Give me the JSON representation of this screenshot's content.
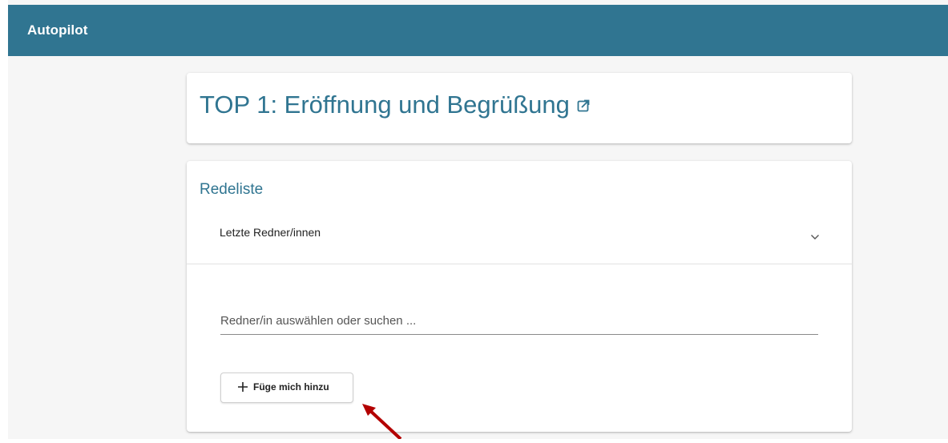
{
  "header": {
    "title": "Autopilot",
    "background_color": "#307591"
  },
  "agenda_item": {
    "title": "TOP 1: Eröffnung und Begrüßung",
    "link_icon": "external-link-icon"
  },
  "speakers": {
    "section_title": "Redeliste",
    "last_speakers_label": "Letzte Redner/innen",
    "expand_icon": "chevron-down-icon",
    "search_placeholder": "Redner/in auswählen oder suchen ...",
    "add_self_label": "Füge mich hinzu",
    "add_icon": "plus-icon"
  },
  "annotation": {
    "icon": "arrow-icon",
    "color": "#b30000"
  }
}
